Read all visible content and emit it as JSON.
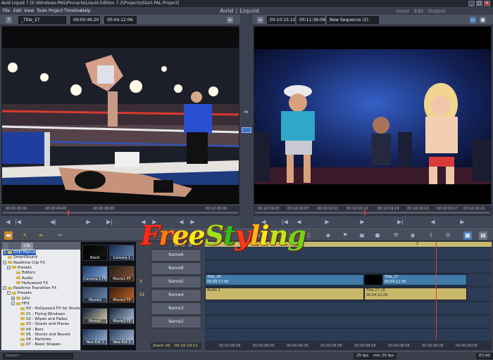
{
  "window": {
    "title": "Avid Liquid 7 [E:\\Windows-PAS\\Pinnacle\\Liquid Edition 7.2\\Projects\\Start-PAL.Project]",
    "controls": [
      "_",
      "□",
      "×"
    ]
  },
  "menu": {
    "items": [
      "File",
      "Edit",
      "View",
      "Tools",
      "Project",
      "Timeline",
      "Help"
    ],
    "brand": "Avid | Liquid",
    "workspaces": [
      "Inout",
      "Edit",
      "Output"
    ]
  },
  "source_viewer": {
    "help": "?",
    "clip_name": "_Title_27",
    "tc_duration": "00:00:46:20",
    "tc_position": "00:04:12:06",
    "ruler_ticks": [
      "00:00:00:00",
      "00:00:04:00",
      "00:00:08:00",
      "00:12:00:00"
    ],
    "playhead_fraction": 0.28
  },
  "record_viewer": {
    "tc_duration": "00:10:15:12",
    "tc_position": "00:11:39:09",
    "sequence_name": "New Sequence (2)",
    "ruler_ticks": [
      "00:10:19:03",
      "00:10:19:07",
      "00:10:19:11",
      "00:10:19:15",
      "00:10:19:19",
      "00:10:19:13",
      "00:10:19:17",
      "00:10:19:21"
    ],
    "playhead_fraction": 0.47
  },
  "library": {
    "tabs": [
      "",
      "Lib"
    ],
    "tree": [
      {
        "label": "DVD Menus",
        "indent": 0,
        "expand": "+",
        "selected": true
      },
      {
        "label": "SmartSound",
        "indent": 0,
        "expand": ""
      },
      {
        "label": "Realtime Clip FX",
        "indent": 0,
        "expand": "-"
      },
      {
        "label": "Presets",
        "indent": 1,
        "expand": "-"
      },
      {
        "label": "Editors",
        "indent": 2,
        "expand": ""
      },
      {
        "label": "Audio",
        "indent": 2,
        "expand": ""
      },
      {
        "label": "Hollywood FX",
        "indent": 2,
        "expand": ""
      },
      {
        "label": "Realtime Transition FX",
        "indent": 0,
        "expand": "-"
      },
      {
        "label": "Presets",
        "indent": 1,
        "expand": "-"
      },
      {
        "label": "GPU",
        "indent": 2,
        "expand": "+"
      },
      {
        "label": "HFX",
        "indent": 2,
        "expand": "-"
      },
      {
        "label": "00 - Hollywood FX for Studio",
        "indent": 3,
        "expand": ""
      },
      {
        "label": "01 - Flying Windows",
        "indent": 3,
        "expand": ""
      },
      {
        "label": "02 - Wipes and Fades",
        "indent": 3,
        "expand": ""
      },
      {
        "label": "03 - Quads and Pieces",
        "indent": 3,
        "expand": ""
      },
      {
        "label": "04 - Bars",
        "indent": 3,
        "expand": ""
      },
      {
        "label": "05 - Stocks and Bevels",
        "indent": 3,
        "expand": ""
      },
      {
        "label": "06 - Particles",
        "indent": 3,
        "expand": ""
      },
      {
        "label": "07 - Basic Shapes",
        "indent": 3,
        "expand": ""
      }
    ]
  },
  "thumbnails": [
    {
      "label": "Blank",
      "colors": [
        "#000000",
        "#1a1a1a"
      ]
    },
    {
      "label": "Camera 1",
      "colors": [
        "#1b2c4f",
        "#6b89b5"
      ]
    },
    {
      "label": "Camera 1 FP",
      "colors": [
        "#1b3a6b",
        "#8db3e6"
      ]
    },
    {
      "label": "Movie1 FP",
      "colors": [
        "#2a1c14",
        "#8a5a3a"
      ]
    },
    {
      "label": "Movie2",
      "colors": [
        "#23364f",
        "#6f8fb7"
      ]
    },
    {
      "label": "Movie2 FP",
      "colors": [
        "#3a1e10",
        "#c26a28"
      ]
    },
    {
      "label": "Movie2",
      "colors": [
        "#0f1c35",
        "#e0d4b2"
      ]
    },
    {
      "label": "Movie3 FP",
      "colors": [
        "#16283f",
        "#b7c8dd"
      ]
    },
    {
      "label": "New Ext 1",
      "colors": [
        "#1d3554",
        "#9fbbe0"
      ]
    },
    {
      "label": "New Ext 2",
      "colors": [
        "#2e4260",
        "#a9c1df"
      ]
    }
  ],
  "timeline": {
    "tracks": [
      {
        "name": "Name6",
        "side": ""
      },
      {
        "name": "Name8",
        "side": ""
      },
      {
        "name": "Name5",
        "side": "V"
      },
      {
        "name": "Name4",
        "side": "S1"
      },
      {
        "name": "Name3",
        "side": ""
      },
      {
        "name": "Name2",
        "side": ""
      }
    ],
    "ruler_label": "2",
    "clips": {
      "video1": "Title_34",
      "video1_tc": "00:00:17:00",
      "video2": "Title_27",
      "video2_tc": "00:04:12:06",
      "audio1": "Audio 1",
      "audio2": "Title 27 (2)",
      "audio2_tc": "00:04:12:06"
    },
    "tc_ticks": [
      "00:00:08:08",
      "00:00:08:08",
      "00:00:08:08",
      "00:00:08:08",
      "00:00:08:08",
      "00:00:08:08",
      "00:00:08:08",
      "00:00:08:08"
    ],
    "zoom_label": "Zoom",
    "zoom_value": "39",
    "position_tc": "00:10:19:12",
    "playhead_fraction": 0.81
  },
  "status": {
    "search_placeholder": "Search",
    "fps_left": "25 fps",
    "fps_right": "min 25 fps",
    "time": "07:43"
  },
  "watermark": "FreeStyling",
  "colors": {
    "panel": "#3b4150",
    "timeline_bg": "#26354a",
    "video_clip": "#3f7aa9",
    "audio_clip": "#c9b86a",
    "playhead": "#e23a3a"
  }
}
